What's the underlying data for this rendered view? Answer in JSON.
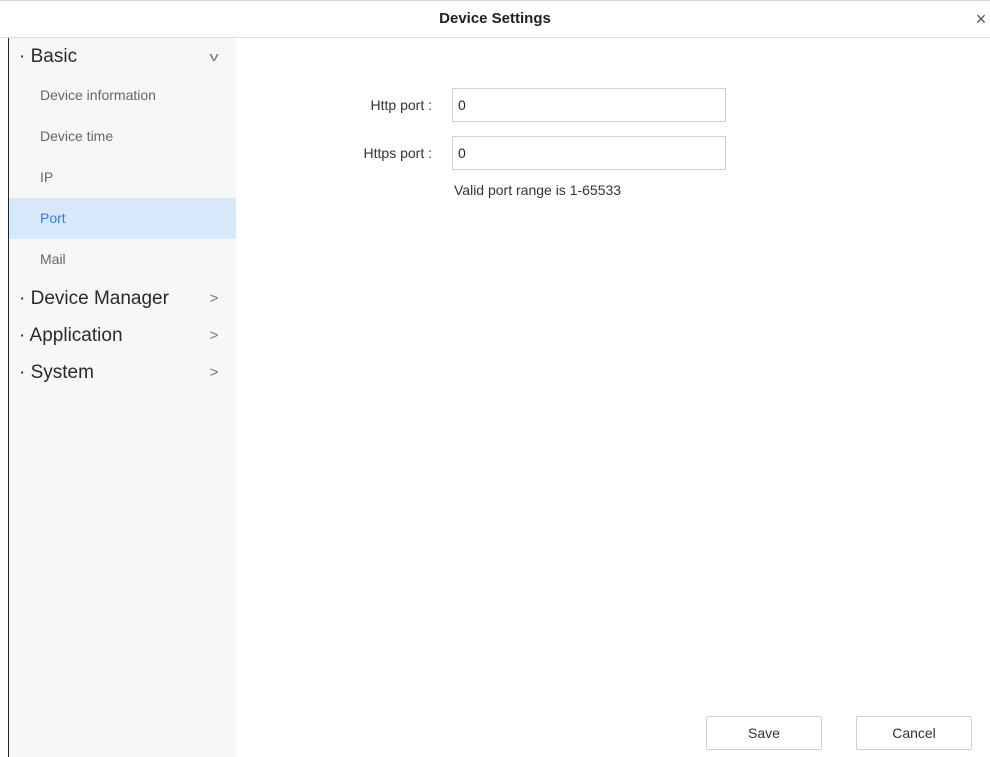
{
  "window": {
    "title": "Device Settings",
    "close_glyph": "×"
  },
  "sidebar": {
    "groups": [
      {
        "label": "· Basic",
        "expanded": true,
        "chevron": "v",
        "items": [
          {
            "label": "Device information",
            "active": false
          },
          {
            "label": "Device time",
            "active": false
          },
          {
            "label": "IP",
            "active": false
          },
          {
            "label": "Port",
            "active": true
          },
          {
            "label": "Mail",
            "active": false
          }
        ]
      },
      {
        "label": "· Device Manager",
        "expanded": false,
        "chevron": ">"
      },
      {
        "label": "· Application",
        "expanded": false,
        "chevron": ">"
      },
      {
        "label": "· System",
        "expanded": false,
        "chevron": ">"
      }
    ]
  },
  "form": {
    "http_port": {
      "label": "Http port :",
      "value": "0"
    },
    "https_port": {
      "label": "Https port :",
      "value": "0"
    },
    "hint": "Valid port range is 1-65533"
  },
  "footer": {
    "save_label": "Save",
    "cancel_label": "Cancel"
  },
  "colors": {
    "active_bg": "#d6e8fa",
    "active_text": "#2f7fd6",
    "sidebar_bg": "#f7f7f7"
  }
}
